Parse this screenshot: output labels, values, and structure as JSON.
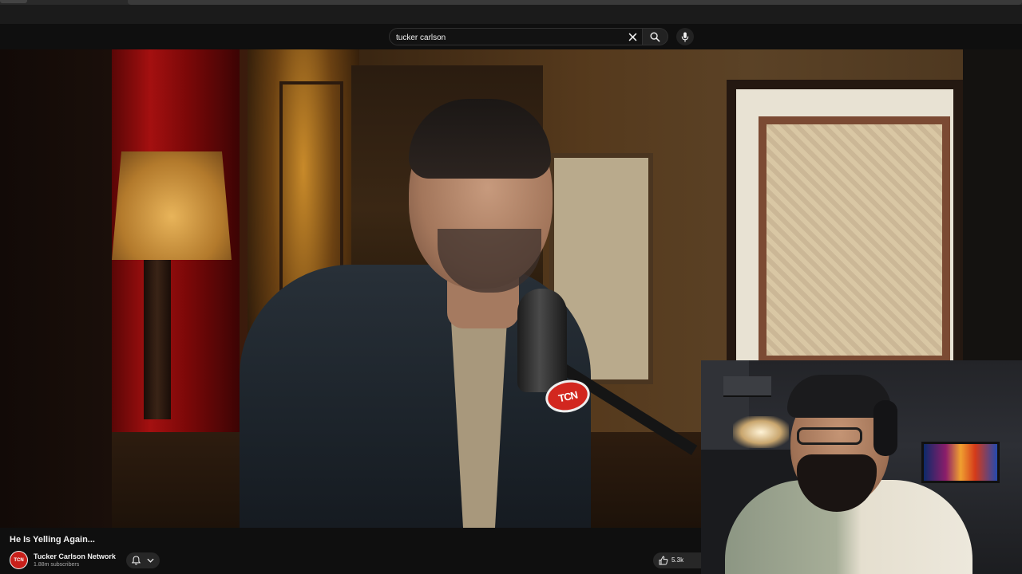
{
  "search": {
    "query": "tucker carlson",
    "clear_icon": "close-icon",
    "search_icon": "search-icon",
    "mic_icon": "microphone-icon"
  },
  "video": {
    "title": "He Is Yelling Again...",
    "mic_flag_text": "TCN"
  },
  "channel": {
    "name": "Tucker Carlson Network",
    "avatar_text": "TCN",
    "subscribers": "1.88m subscribers",
    "bell_icon": "bell-icon",
    "chevron_icon": "chevron-down-icon"
  },
  "actions": {
    "like_count": "5.3k",
    "like_icon": "thumbs-up-icon"
  },
  "colors": {
    "background": "#0f0f0f",
    "accent_red": "#c8201b",
    "button_bg": "#272727"
  }
}
